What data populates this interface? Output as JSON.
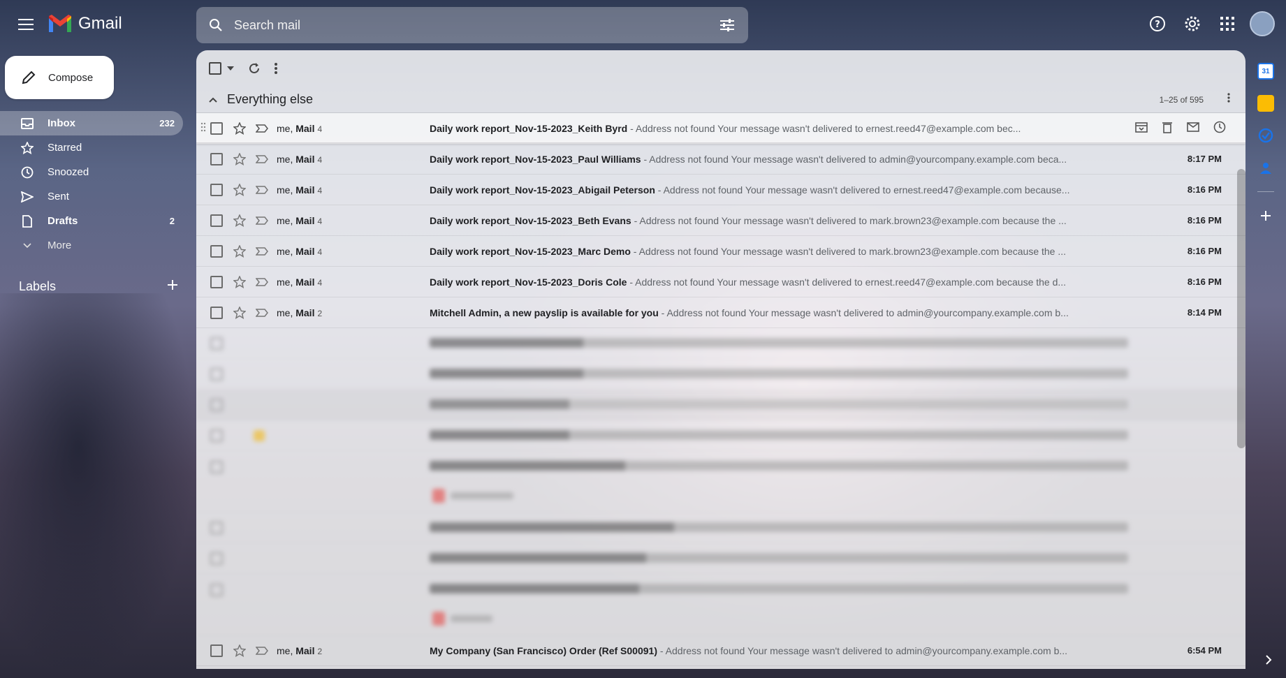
{
  "app": {
    "name": "Gmail"
  },
  "search": {
    "placeholder": "Search mail"
  },
  "compose": {
    "label": "Compose"
  },
  "nav": {
    "items": [
      {
        "label": "Inbox",
        "count": "232",
        "icon": "inbox-icon",
        "active": true
      },
      {
        "label": "Starred",
        "count": "",
        "icon": "star-icon"
      },
      {
        "label": "Snoozed",
        "count": "",
        "icon": "clock-icon"
      },
      {
        "label": "Sent",
        "count": "",
        "icon": "send-icon"
      },
      {
        "label": "Drafts",
        "count": "2",
        "icon": "draft-icon",
        "bold": true
      },
      {
        "label": "More",
        "count": "",
        "icon": "chevron-down-icon"
      }
    ],
    "labels_title": "Labels"
  },
  "section": {
    "title": "Everything else",
    "range": "1–25 of 595"
  },
  "rows": [
    {
      "sender_me": "me, ",
      "sender": "Mail",
      "count": "4",
      "subject": "Daily work report_Nov-15-2023_Keith Byrd",
      "snippet": " - Address not found Your message wasn't delivered to ernest.reed47@example.com bec...",
      "time": "",
      "hover": true
    },
    {
      "sender_me": "me, ",
      "sender": "Mail",
      "count": "4",
      "subject": "Daily work report_Nov-15-2023_Paul Williams",
      "snippet": " - Address not found Your message wasn't delivered to admin@yourcompany.example.com beca...",
      "time": "8:17 PM"
    },
    {
      "sender_me": "me, ",
      "sender": "Mail",
      "count": "4",
      "subject": "Daily work report_Nov-15-2023_Abigail Peterson",
      "snippet": " - Address not found Your message wasn't delivered to ernest.reed47@example.com because...",
      "time": "8:16 PM"
    },
    {
      "sender_me": "me, ",
      "sender": "Mail",
      "count": "4",
      "subject": "Daily work report_Nov-15-2023_Beth Evans",
      "snippet": " - Address not found Your message wasn't delivered to mark.brown23@example.com because the ...",
      "time": "8:16 PM"
    },
    {
      "sender_me": "me, ",
      "sender": "Mail",
      "count": "4",
      "subject": "Daily work report_Nov-15-2023_Marc Demo",
      "snippet": " - Address not found Your message wasn't delivered to mark.brown23@example.com because the ...",
      "time": "8:16 PM"
    },
    {
      "sender_me": "me, ",
      "sender": "Mail",
      "count": "4",
      "subject": "Daily work report_Nov-15-2023_Doris Cole",
      "snippet": " - Address not found Your message wasn't delivered to ernest.reed47@example.com because the d...",
      "time": "8:16 PM"
    },
    {
      "sender_me": "me, ",
      "sender": "Mail",
      "count": "2",
      "subject": "Mitchell Admin, a new payslip is available for you",
      "snippet": " - Address not found Your message wasn't delivered to admin@yourcompany.example.com b...",
      "time": "8:14 PM"
    }
  ],
  "last_row": {
    "sender_me": "me, ",
    "sender": "Mail",
    "count": "2",
    "subject": "My Company (San Francisco) Order (Ref S00091)",
    "snippet": " - Address not found Your message wasn't delivered to admin@yourcompany.example.com b...",
    "time": "6:54 PM"
  },
  "side_panel": {
    "calendar_day": "31"
  }
}
